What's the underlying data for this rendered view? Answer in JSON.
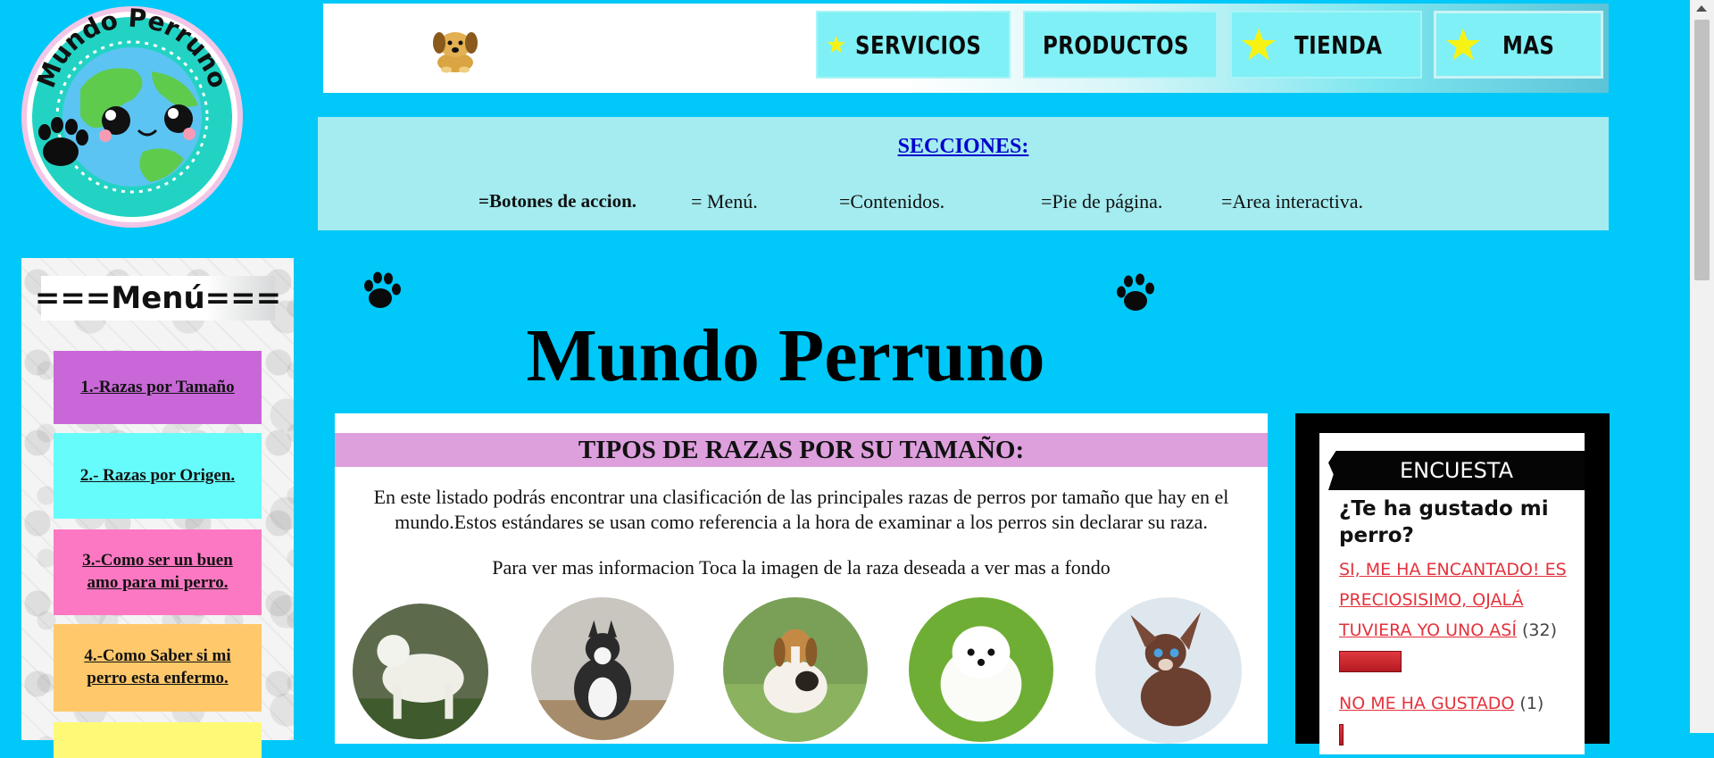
{
  "logo": {
    "text": "Mundo Perruno"
  },
  "nav": {
    "items": [
      {
        "label": "SERVICIOS"
      },
      {
        "label": "PRODUCTOS"
      },
      {
        "label": "TIENDA"
      },
      {
        "label": "MAS"
      }
    ]
  },
  "sections": {
    "title": "SECCIONES:",
    "items": [
      {
        "label": "=Botones de accion."
      },
      {
        "label": "= Menú."
      },
      {
        "label": "=Contenidos."
      },
      {
        "label": "=Pie de página."
      },
      {
        "label": "=Area interactiva."
      }
    ]
  },
  "menu": {
    "title": "===Menú===",
    "items": [
      {
        "label": "1.-Razas por Tamaño",
        "color": "#c967d8"
      },
      {
        "label": "2.- Razas por Origen.",
        "color": "#66fcfb"
      },
      {
        "label": "3.-Como ser un buen amo para mi perro.",
        "color": "#fc78c2"
      },
      {
        "label": "4.-Como Saber si mi perro esta enfermo.",
        "color": "#ffc96b"
      },
      {
        "label": "",
        "color": "#fff978"
      }
    ]
  },
  "main": {
    "title": "Mundo Perruno",
    "heading": "TIPOS DE RAZAS POR SU TAMAÑO:",
    "description": "En este listado podrás encontrar una clasificación de las principales razas de perros por tamaño que hay en el mundo.Estos estándares se usan como referencia a la hora de examinar a los perros sin declarar su raza.",
    "hint": "Para ver mas informacion Toca la imagen de la raza deseada a ver mas a fondo"
  },
  "breed_images": [
    "white-large-dog",
    "husky",
    "beagle",
    "maltese",
    "chihuahua"
  ],
  "poll": {
    "header": "ENCUESTA",
    "question": "¿Te ha gustado mi perro?",
    "options": [
      {
        "label": "SI, ME HA ENCANTADO! ES PRECIOSISIMO, OJALÁ TUVIERA YO UNO ASÍ",
        "count": "(32)",
        "votes": 32
      },
      {
        "label": "NO ME HA GUSTADO",
        "count": "(1)",
        "votes": 1
      }
    ]
  },
  "colors": {
    "page_bg": "#00c8f8",
    "nav_button": "#7ff0f5",
    "sections_bg": "#a4ecf0",
    "heading_bg": "#dda0dd",
    "poll_link": "#e4323c"
  }
}
